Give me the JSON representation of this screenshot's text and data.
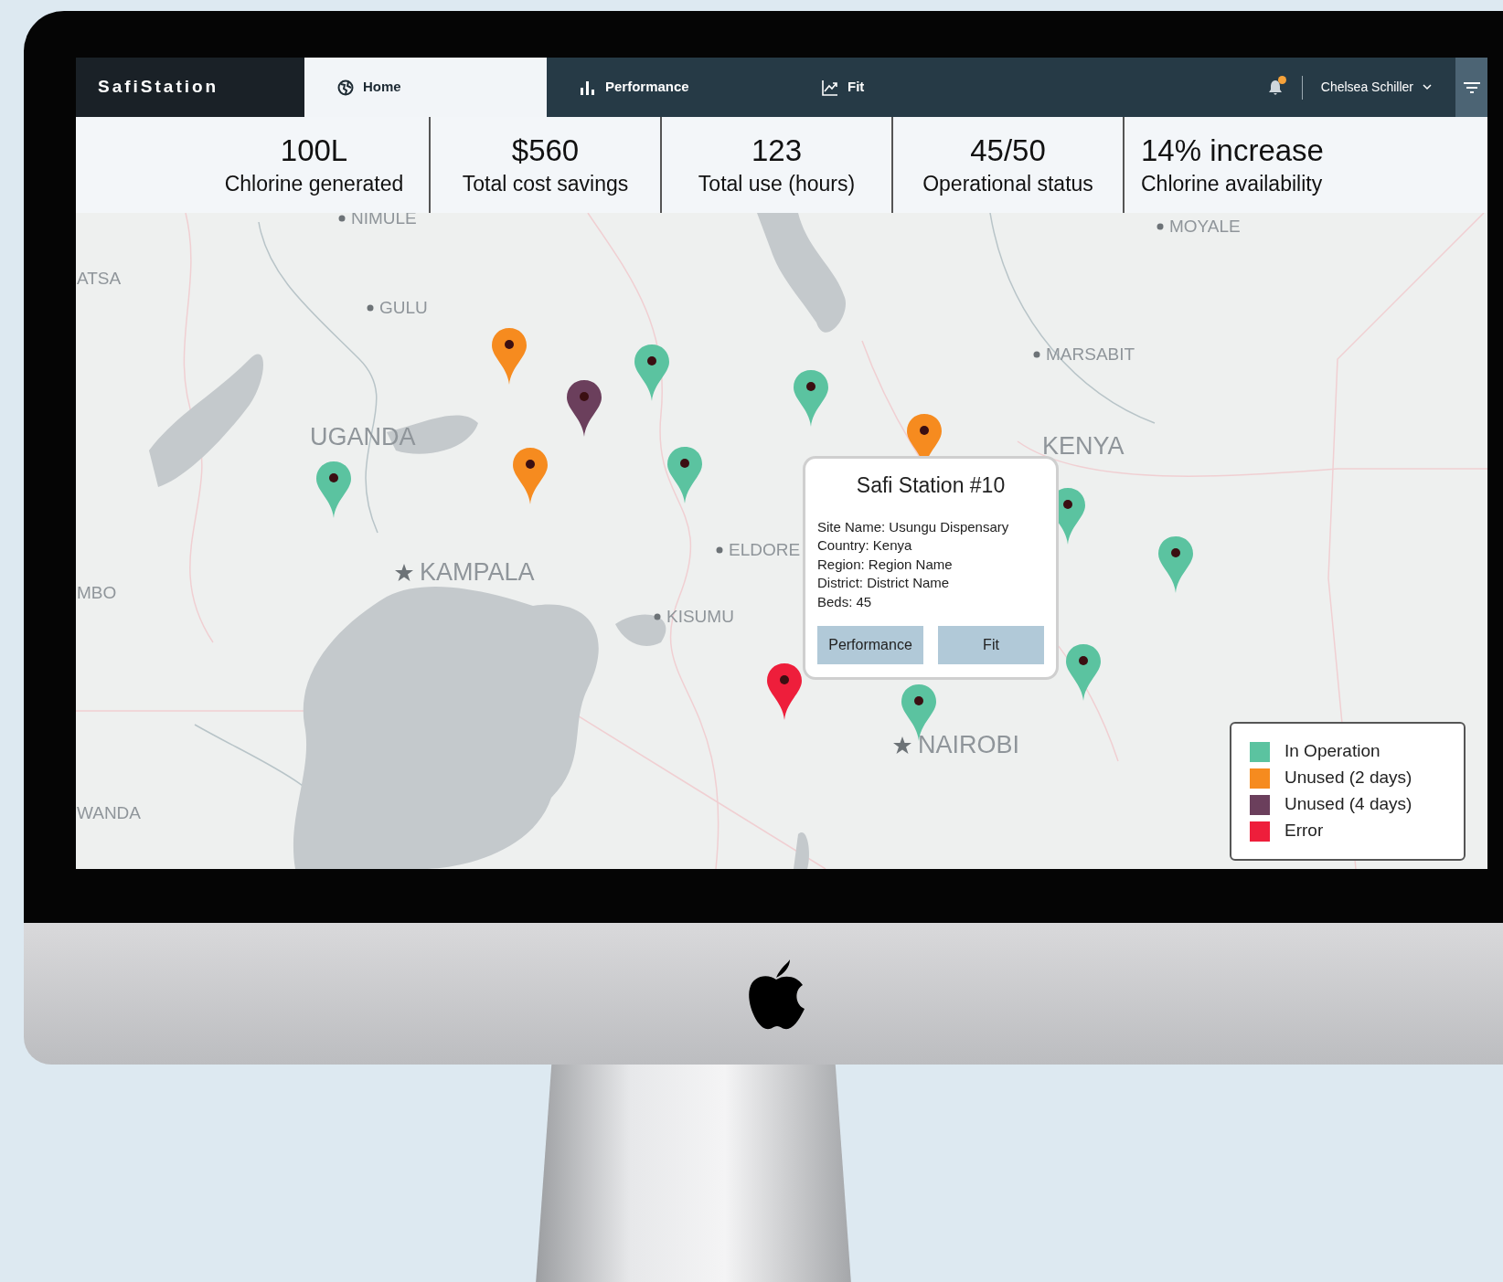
{
  "nav": {
    "brand": "SafiStation",
    "tabs": [
      {
        "label": "Home",
        "selected": true
      },
      {
        "label": "Performance",
        "selected": false
      },
      {
        "label": "Fit",
        "selected": false
      }
    ],
    "notification": true,
    "user": "Chelsea Schiller"
  },
  "stats": [
    {
      "value": "100L",
      "label": "Chlorine generated"
    },
    {
      "value": "$560",
      "label": "Total cost savings"
    },
    {
      "value": "123",
      "label": "Total use (hours)"
    },
    {
      "value": "45/50",
      "label": "Operational status"
    },
    {
      "value": "14% increase",
      "label": "Chlorine availability"
    }
  ],
  "map": {
    "labels": [
      {
        "text": "NIMULE",
        "kind": "city"
      },
      {
        "text": "ATSA",
        "kind": "region"
      },
      {
        "text": "GULU",
        "kind": "city"
      },
      {
        "text": "UGANDA",
        "kind": "country"
      },
      {
        "text": "KAMPALA",
        "kind": "capital"
      },
      {
        "text": "MBO",
        "kind": "region"
      },
      {
        "text": "ELDORE",
        "kind": "city"
      },
      {
        "text": "KISUMU",
        "kind": "city"
      },
      {
        "text": "MARSABIT",
        "kind": "city"
      },
      {
        "text": "KENYA",
        "kind": "country"
      },
      {
        "text": "MOYALE",
        "kind": "city"
      },
      {
        "text": "NAIROBI",
        "kind": "capital"
      },
      {
        "text": "WANDA",
        "kind": "region"
      }
    ],
    "markers": [
      {
        "color": "#f68b1f"
      },
      {
        "color": "#5bc3a0"
      },
      {
        "color": "#6b3f5c"
      },
      {
        "color": "#5bc3a0"
      },
      {
        "color": "#f68b1f"
      },
      {
        "color": "#f68b1f"
      },
      {
        "color": "#5bc3a0"
      },
      {
        "color": "#5bc3a0"
      },
      {
        "color": "#5bc3a0"
      },
      {
        "color": "#5bc3a0"
      },
      {
        "color": "#5bc3a0"
      },
      {
        "color": "#ee1e3b"
      },
      {
        "color": "#5bc3a0"
      }
    ],
    "popup": {
      "title": "Safi Station #10",
      "lines": [
        "Site Name: Usungu Dispensary",
        "Country: Kenya",
        "Region: Region Name",
        "District: District Name",
        "Beds: 45"
      ],
      "buttons": [
        "Performance",
        "Fit"
      ]
    },
    "legend": [
      {
        "label": "In Operation",
        "color": "#5bc3a0"
      },
      {
        "label": "Unused (2 days)",
        "color": "#f68b1f"
      },
      {
        "label": "Unused (4 days)",
        "color": "#6b3f5c"
      },
      {
        "label": "Error",
        "color": "#ee1e3b"
      }
    ]
  }
}
